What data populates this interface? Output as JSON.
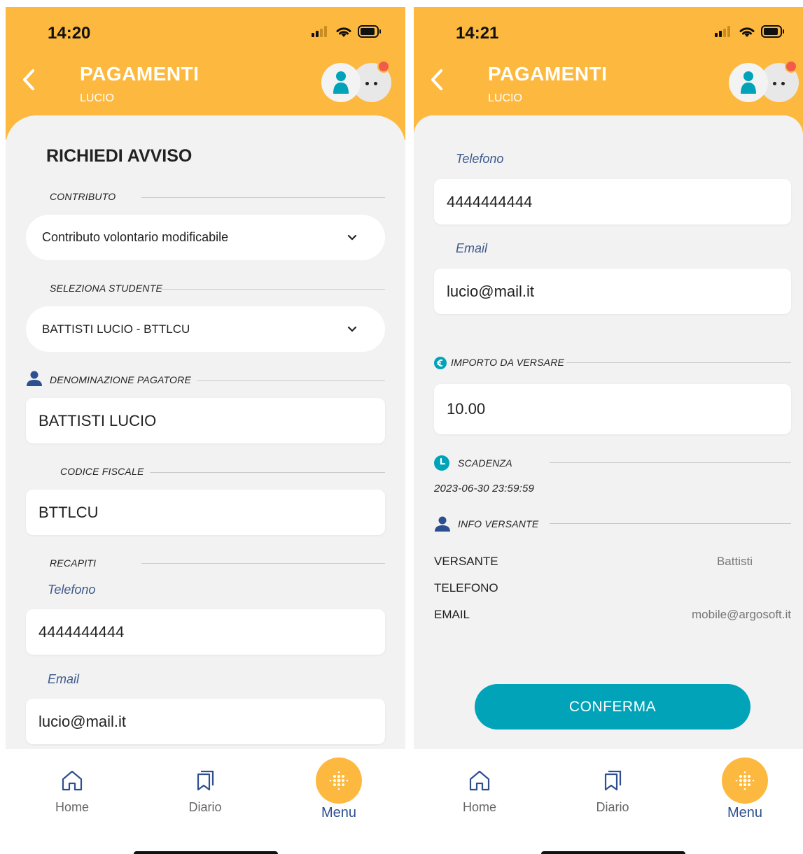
{
  "screen1": {
    "time": "14:20",
    "title": "PAGAMENTI",
    "subtitle": "LUCIO",
    "section_title": "RICHIEDI AVVISO",
    "contributo_label": "CONTRIBUTO",
    "contributo_value": "Contributo volontario modificabile",
    "studente_label": "SELEZIONA STUDENTE",
    "studente_value": "BATTISTI LUCIO - BTTLCU",
    "pagatore_label": "DENOMINAZIONE PAGATORE",
    "pagatore_value": "BATTISTI LUCIO",
    "cf_label": "CODICE FISCALE",
    "cf_value": "BTTLCU",
    "recapiti_label": "RECAPITI",
    "telefono_label": "Telefono",
    "telefono_value": "4444444444",
    "email_label": "Email",
    "email_value": "lucio@mail.it"
  },
  "screen2": {
    "time": "14:21",
    "title": "PAGAMENTI",
    "subtitle": "LUCIO",
    "telefono_label": "Telefono",
    "telefono_value": "4444444444",
    "email_label": "Email",
    "email_value": "lucio@mail.it",
    "importo_label": "IMPORTO DA VERSARE",
    "importo_value": "10.00",
    "scadenza_label": "SCADENZA",
    "scadenza_value": "2023-06-30 23:59:59",
    "info_label": "INFO VERSANTE",
    "info_rows": [
      {
        "label": "VERSANTE",
        "value": "Battisti"
      },
      {
        "label": "TELEFONO",
        "value": ""
      },
      {
        "label": "EMAIL",
        "value": "mobile@argosoft.it"
      }
    ],
    "confirm_label": "CONFERMA"
  },
  "nav": {
    "home": "Home",
    "diario": "Diario",
    "menu": "Menu"
  },
  "colors": {
    "header": "#FDB93F",
    "accent": "#00A3B8",
    "menu_text": "#2E4F8F",
    "sublabel": "#3D5A8C"
  }
}
